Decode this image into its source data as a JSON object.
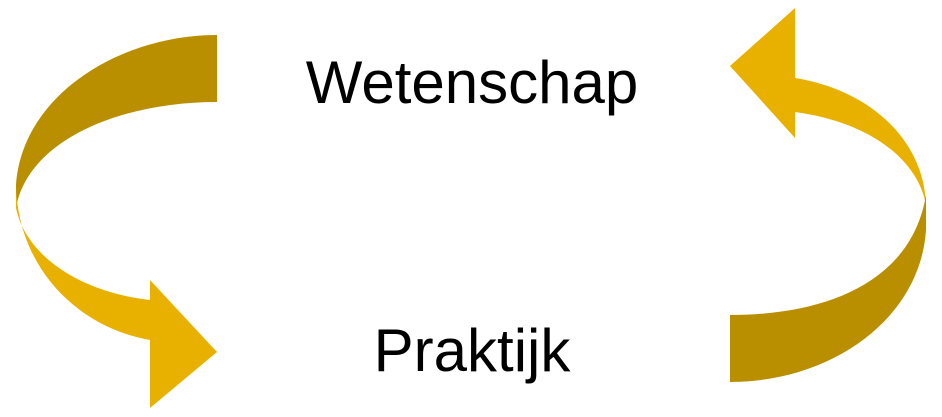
{
  "diagram": {
    "top_label": "Wetenschap",
    "bottom_label": "Praktijk"
  },
  "colors": {
    "arrow_light": "#E8B100",
    "arrow_dark": "#B98F00",
    "text": "#000000",
    "background": "#FFFFFF"
  },
  "icons": {
    "left_arrow": "curved-arrow-down-right-icon",
    "right_arrow": "curved-arrow-up-left-icon"
  }
}
